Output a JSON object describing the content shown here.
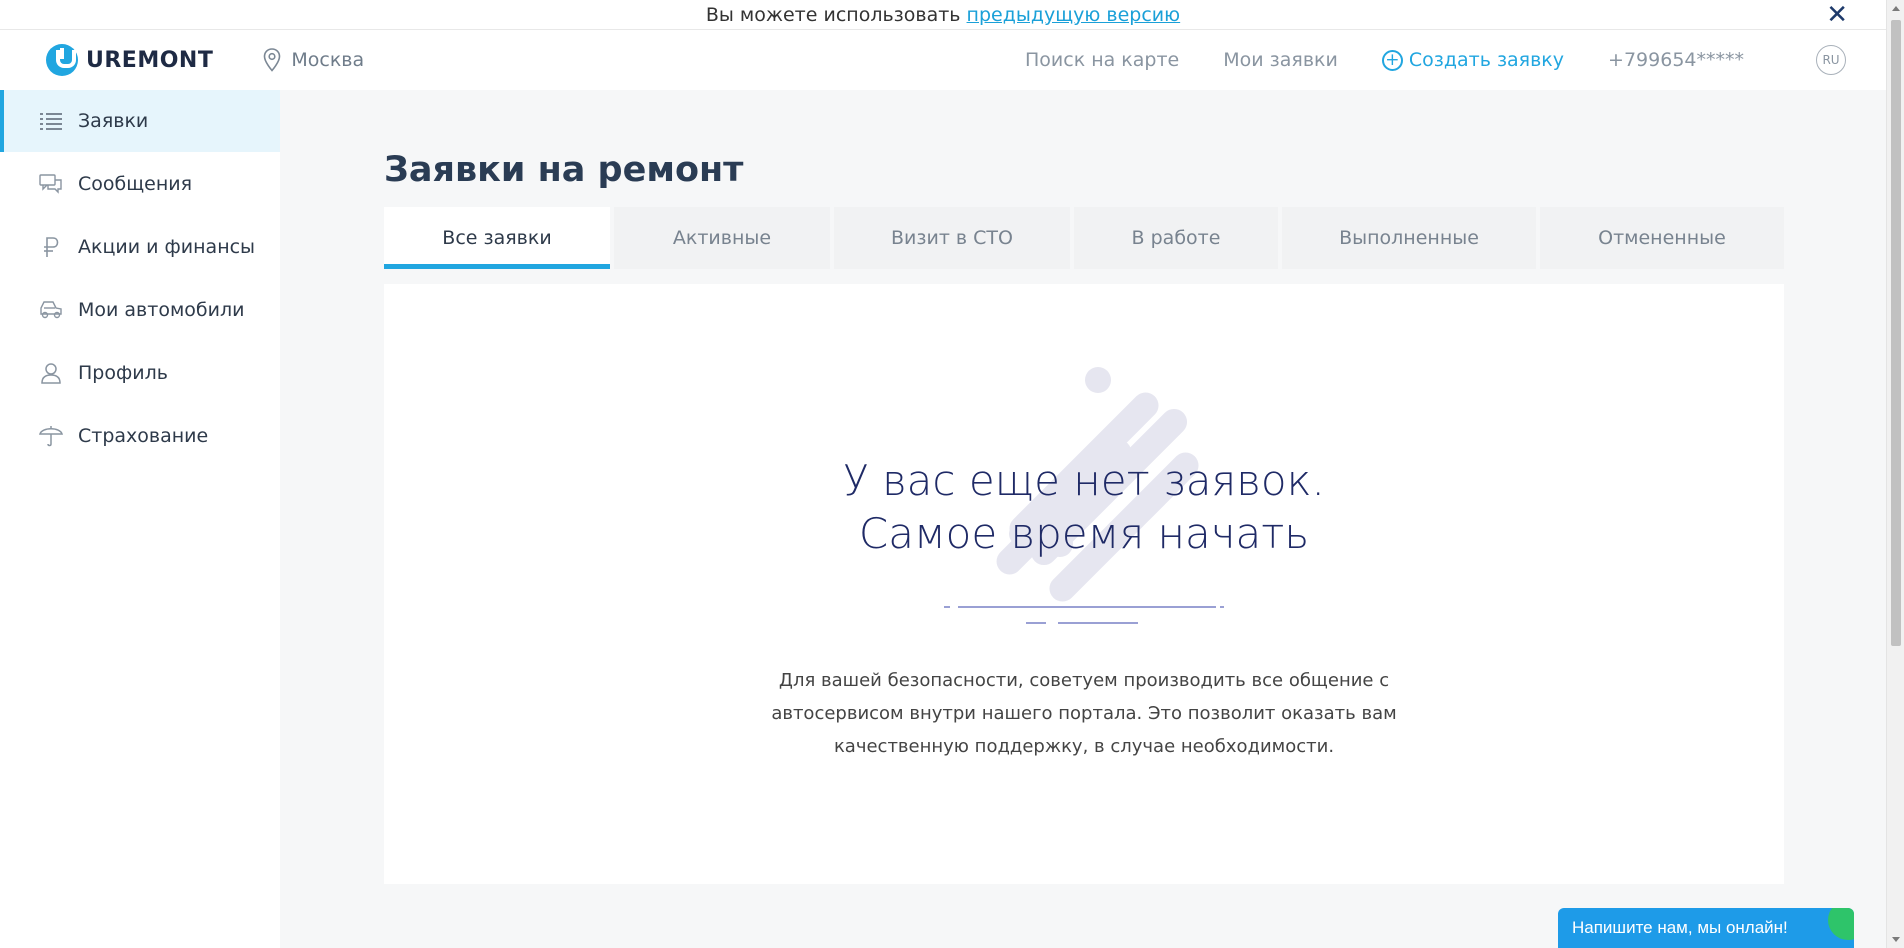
{
  "notice": {
    "text": "Вы можете использовать ",
    "link": "предыдущую версию"
  },
  "header": {
    "logo_text": "UREMONT",
    "city": "Москва",
    "nav": {
      "map": "Поиск на карте",
      "my_requests": "Мои заявки",
      "create": "Создать заявку",
      "phone": "+799654*****"
    },
    "lang": "RU"
  },
  "sidebar": {
    "items": [
      {
        "label": "Заявки",
        "icon": "list-icon",
        "active": true
      },
      {
        "label": "Сообщения",
        "icon": "chat-bubbles-icon",
        "active": false
      },
      {
        "label": "Акции и финансы",
        "icon": "ruble-icon",
        "active": false
      },
      {
        "label": "Мои автомобили",
        "icon": "car-icon",
        "active": false
      },
      {
        "label": "Профиль",
        "icon": "user-icon",
        "active": false
      },
      {
        "label": "Страхование",
        "icon": "umbrella-icon",
        "active": false
      }
    ]
  },
  "main": {
    "title": "Заявки на ремонт",
    "tabs": [
      {
        "label": "Все заявки",
        "active": true
      },
      {
        "label": "Активные",
        "active": false
      },
      {
        "label": "Визит в СТО",
        "active": false
      },
      {
        "label": "В работе",
        "active": false
      },
      {
        "label": "Выполненные",
        "active": false
      },
      {
        "label": "Отмененные",
        "active": false
      }
    ],
    "empty": {
      "heading_line1": "У вас еще нет заявок.",
      "heading_line2": "Самое время начать",
      "note_line1": "Для вашей безопасности, советуем производить все общение с",
      "note_line2": "автосервисом внутри нашего портала. Это позволит оказать вам",
      "note_line3": "качественную поддержку, в случае необходимости."
    }
  },
  "chat": {
    "label": "Напишите нам, мы онлайн!"
  },
  "colors": {
    "accent": "#21a6e0",
    "heading": "#1f2a66",
    "chat": "#1e9be8",
    "online": "#2ec46a"
  }
}
